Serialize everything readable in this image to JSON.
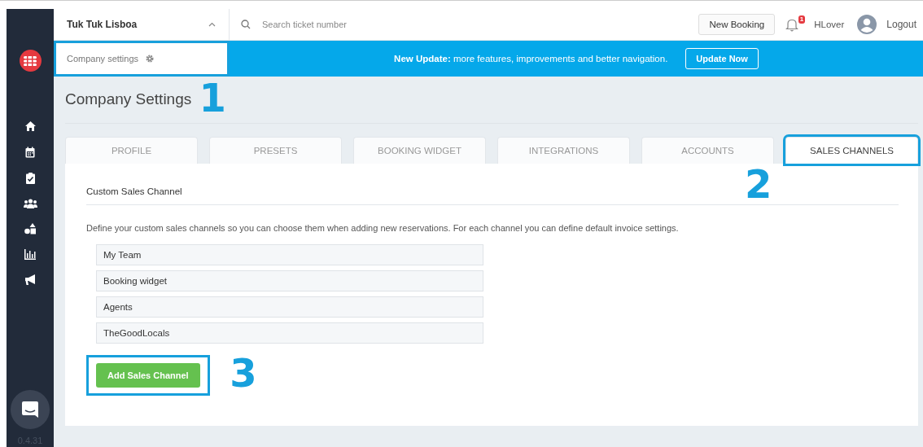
{
  "sidebar": {
    "version": "0.4.31"
  },
  "topbar": {
    "company": "Tuk Tuk Lisboa",
    "search_placeholder": "Search ticket number",
    "new_booking": "New Booking",
    "notifications": "1",
    "user": "HLover",
    "logout": "Logout"
  },
  "company_settings_link": {
    "label": "Company settings",
    "callout": "1"
  },
  "banner": {
    "text": "**New Update:** more features, improvements and better navigation.",
    "button": "Update Now"
  },
  "page_title": "Company Settings",
  "tabs": [
    {
      "label": "PROFILE",
      "selected": false
    },
    {
      "label": "PRESETS",
      "selected": false
    },
    {
      "label": "BOOKING WIDGET",
      "selected": false
    },
    {
      "label": "INTEGRATIONS",
      "selected": false
    },
    {
      "label": "ACCOUNTS",
      "selected": false
    },
    {
      "label": "SALES CHANNELS",
      "selected": true,
      "callout": "2"
    }
  ],
  "section": {
    "heading": "Custom Sales Channel",
    "description": "Define your custom sales channels so you can choose them when adding new reservations. For each channel you can define default invoice settings.",
    "channels": [
      "My Team",
      "Booking widget",
      "Agents",
      "TheGoodLocals"
    ],
    "add_button": {
      "label": "Add Sales Channel",
      "callout": "3"
    }
  }
}
